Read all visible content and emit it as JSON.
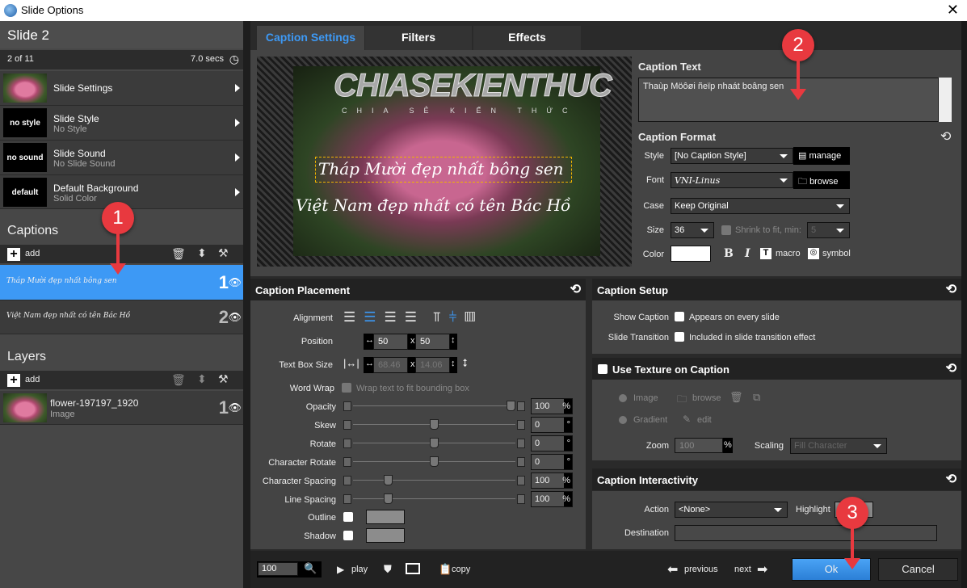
{
  "window": {
    "title": "Slide Options",
    "close": "✕"
  },
  "left": {
    "slide_title": "Slide 2",
    "position": "2 of 11",
    "duration": "7.0 secs",
    "rows": [
      {
        "title": "Slide Settings",
        "sub": "",
        "thumb": ""
      },
      {
        "title": "Slide Style",
        "sub": "No Style",
        "thumb": "no style"
      },
      {
        "title": "Slide Sound",
        "sub": "No Slide Sound",
        "thumb": "no sound"
      },
      {
        "title": "Default Background",
        "sub": "Solid Color",
        "thumb": "default"
      }
    ],
    "captions": {
      "title": "Captions",
      "add": "add",
      "items": [
        {
          "text": "Tháp Mười đẹp nhất bông sen",
          "num": "1"
        },
        {
          "text": "Việt Nam đẹp nhất có tên Bác Hồ",
          "num": "2"
        }
      ]
    },
    "layers": {
      "title": "Layers",
      "add": "add",
      "items": [
        {
          "name": "flower-197197_1920",
          "type": "Image",
          "num": "1"
        }
      ]
    }
  },
  "tabs": [
    {
      "label": "Caption Settings",
      "active": true
    },
    {
      "label": "Filters"
    },
    {
      "label": "Effects"
    }
  ],
  "preview": {
    "watermark": "CHIASEKIENTHUC",
    "watermark_sub": "CHIA SẺ KIẾN THỨC",
    "line1": "Tháp Mười đẹp nhất bông sen",
    "line2": "Việt Nam đẹp nhất có tên Bác Hồ"
  },
  "caption_text": {
    "title": "Caption Text",
    "value": "Thaùp Möôøi ñeïp nhaát boâng sen"
  },
  "caption_format": {
    "title": "Caption Format",
    "style_label": "Style",
    "style_value": "[No Caption Style]",
    "manage": "manage",
    "font_label": "Font",
    "font_value": "VNI-Linus",
    "browse": "browse",
    "case_label": "Case",
    "case_value": "Keep Original",
    "size_label": "Size",
    "size_value": "36",
    "shrink": "Shrink to fit, min:",
    "shrink_min": "5",
    "color_label": "Color",
    "color_value": "#ffffff",
    "bold": "B",
    "italic": "I",
    "macro": "macro",
    "symbol": "symbol"
  },
  "placement": {
    "title": "Caption Placement",
    "alignment": "Alignment",
    "position": "Position",
    "pos_x": "50",
    "pos_y": "50",
    "x": "x",
    "textbox": "Text Box Size",
    "tb_w": "68.46",
    "tb_h": "14.06",
    "wordwrap": "Word Wrap",
    "wordwrap_text": "Wrap text to fit bounding box",
    "sliders": [
      {
        "label": "Opacity",
        "value": "100",
        "unit": "%",
        "fraction": 1.0
      },
      {
        "label": "Skew",
        "value": "0",
        "unit": "°",
        "fraction": 0.5
      },
      {
        "label": "Rotate",
        "value": "0",
        "unit": "°",
        "fraction": 0.5
      },
      {
        "label": "Character Rotate",
        "value": "0",
        "unit": "°",
        "fraction": 0.5
      },
      {
        "label": "Character Spacing",
        "value": "100",
        "unit": "%",
        "fraction": 0.2
      },
      {
        "label": "Line Spacing",
        "value": "100",
        "unit": "%",
        "fraction": 0.2
      }
    ],
    "outline": "Outline",
    "shadow": "Shadow"
  },
  "setup": {
    "title": "Caption Setup",
    "show_caption": "Show Caption",
    "show_caption_text": "Appears on every slide",
    "transition": "Slide Transition",
    "transition_text": "Included in slide transition effect"
  },
  "texture": {
    "title": "Use Texture on Caption",
    "image": "Image",
    "browse": "browse",
    "gradient": "Gradient",
    "edit": "edit",
    "zoom": "Zoom",
    "zoom_value": "100",
    "zoom_unit": "%",
    "scaling": "Scaling",
    "scaling_value": "Fill Character"
  },
  "interactivity": {
    "title": "Caption Interactivity",
    "action": "Action",
    "action_value": "<None>",
    "highlight": "Highlight",
    "destination": "Destination",
    "destination_value": ""
  },
  "bottom": {
    "zoom": "100",
    "play": "play",
    "copy": "copy",
    "previous": "previous",
    "next": "next",
    "ok": "Ok",
    "cancel": "Cancel"
  },
  "annotations": [
    "1",
    "2",
    "3"
  ],
  "colors": {
    "accent": "#3d99f5",
    "badge": "#e8393f"
  }
}
